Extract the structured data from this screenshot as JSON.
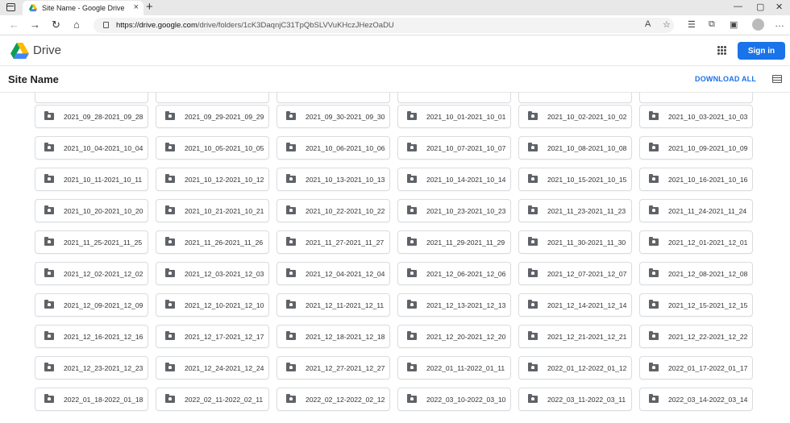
{
  "browser": {
    "tab_title": "Site Name - Google Drive",
    "tab_close": "×",
    "new_tab": "+",
    "window_controls": [
      "—",
      "▢",
      "✕"
    ],
    "url_host": "https://drive.google.com",
    "url_path": "/drive/folders/1cK3DaqnjC31TpQbSLVVuKHczJHezOaDU"
  },
  "drive": {
    "app_name": "Drive",
    "sign_in_label": "Sign in"
  },
  "site": {
    "title": "Site Name",
    "download_all_label": "DOWNLOAD ALL"
  },
  "folders": [
    "2021_09_28-2021_09_28",
    "2021_09_29-2021_09_29",
    "2021_09_30-2021_09_30",
    "2021_10_01-2021_10_01",
    "2021_10_02-2021_10_02",
    "2021_10_03-2021_10_03",
    "2021_10_04-2021_10_04",
    "2021_10_05-2021_10_05",
    "2021_10_06-2021_10_06",
    "2021_10_07-2021_10_07",
    "2021_10_08-2021_10_08",
    "2021_10_09-2021_10_09",
    "2021_10_11-2021_10_11",
    "2021_10_12-2021_10_12",
    "2021_10_13-2021_10_13",
    "2021_10_14-2021_10_14",
    "2021_10_15-2021_10_15",
    "2021_10_16-2021_10_16",
    "2021_10_20-2021_10_20",
    "2021_10_21-2021_10_21",
    "2021_10_22-2021_10_22",
    "2021_10_23-2021_10_23",
    "2021_11_23-2021_11_23",
    "2021_11_24-2021_11_24",
    "2021_11_25-2021_11_25",
    "2021_11_26-2021_11_26",
    "2021_11_27-2021_11_27",
    "2021_11_29-2021_11_29",
    "2021_11_30-2021_11_30",
    "2021_12_01-2021_12_01",
    "2021_12_02-2021_12_02",
    "2021_12_03-2021_12_03",
    "2021_12_04-2021_12_04",
    "2021_12_06-2021_12_06",
    "2021_12_07-2021_12_07",
    "2021_12_08-2021_12_08",
    "2021_12_09-2021_12_09",
    "2021_12_10-2021_12_10",
    "2021_12_11-2021_12_11",
    "2021_12_13-2021_12_13",
    "2021_12_14-2021_12_14",
    "2021_12_15-2021_12_15",
    "2021_12_16-2021_12_16",
    "2021_12_17-2021_12_17",
    "2021_12_18-2021_12_18",
    "2021_12_20-2021_12_20",
    "2021_12_21-2021_12_21",
    "2021_12_22-2021_12_22",
    "2021_12_23-2021_12_23",
    "2021_12_24-2021_12_24",
    "2021_12_27-2021_12_27",
    "2022_01_11-2022_01_11",
    "2022_01_12-2022_01_12",
    "2022_01_17-2022_01_17",
    "2022_01_18-2022_01_18",
    "2022_02_11-2022_02_11",
    "2022_02_12-2022_02_12",
    "2022_03_10-2022_03_10",
    "2022_03_11-2022_03_11",
    "2022_03_14-2022_03_14"
  ]
}
